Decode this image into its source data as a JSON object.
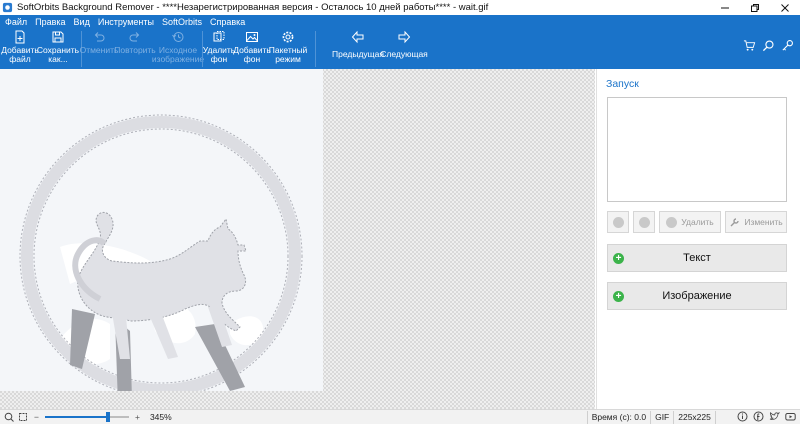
{
  "window": {
    "title": "SoftOrbits Background Remover - ****Незарегистрированная версия - Осталось 10 дней работы**** - wait.gif"
  },
  "menu": [
    {
      "label": "Файл"
    },
    {
      "label": "Правка"
    },
    {
      "label": "Вид"
    },
    {
      "label": "Инструменты"
    },
    {
      "label": "SoftOrbits"
    },
    {
      "label": "Справка"
    }
  ],
  "toolbar": {
    "add_file": "Добавить файл",
    "save_as": "Сохранить как...",
    "undo": "Отменить",
    "redo": "Повторить",
    "original": "Исходное изображение",
    "remove_bg": "Удалить фон",
    "add_bg": "Добавить фон",
    "batch": "Пакетный режим",
    "prev": "Предыдущая",
    "next": "Следующая"
  },
  "panel": {
    "title": "Запуск",
    "delete_label": "Удалить",
    "edit_label": "Изменить",
    "text_button": "Текст",
    "image_button": "Изображение"
  },
  "status": {
    "zoom": "345%",
    "zoom_fraction": 0.75,
    "time": "Время (с): 0.0",
    "format": "GIF",
    "size": "225x225"
  },
  "icons": [
    "app-icon",
    "minimize-icon",
    "restore-icon",
    "close-icon",
    "add-file-icon",
    "save-icon",
    "undo-icon",
    "redo-icon",
    "history-icon",
    "remove-bg-icon",
    "add-bg-icon",
    "gear-icon",
    "arrow-left-icon",
    "arrow-right-icon",
    "cart-icon",
    "search-icon",
    "key-icon",
    "zoom-in-icon",
    "fit-icon",
    "info-icon",
    "facebook-icon",
    "twitter-icon",
    "youtube-icon"
  ],
  "colors": {
    "accent": "#1a73c9",
    "add_green": "#3bb34a"
  }
}
